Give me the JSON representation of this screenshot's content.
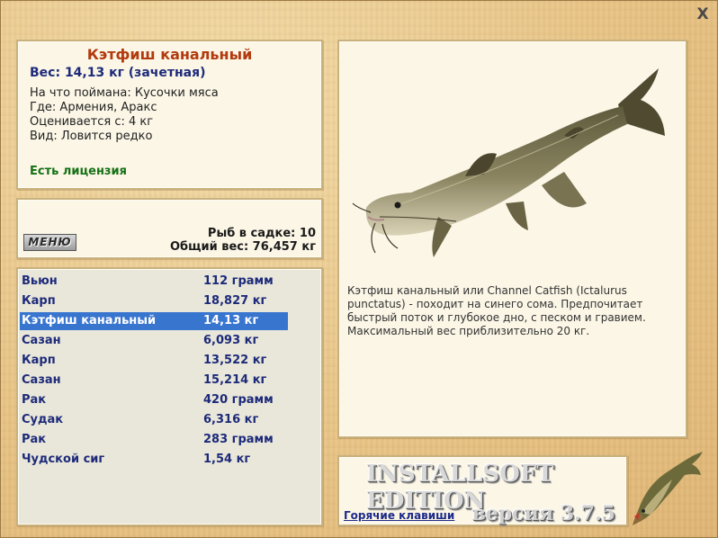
{
  "window": {
    "close_label": "X"
  },
  "info": {
    "title": "Кэтфиш канальный",
    "weight": "Вес: 14,13 кг (зачетная)",
    "caught_on": "На что поймана: Кусочки мяса",
    "location": "Где: Армения, Аракс",
    "rated_from": "Оценивается с: 4 кг",
    "kind": "Вид: Ловится редко",
    "license": "Есть лицензия"
  },
  "keep": {
    "menu_label": "МЕНЮ",
    "fish_count": "Рыб в садке: 10",
    "total_weight": "Общий вес: 76,457 кг"
  },
  "catch_list": [
    {
      "name": "Вьюн",
      "weight": "112 грамм",
      "selected": false
    },
    {
      "name": "Карп",
      "weight": "18,827 кг",
      "selected": false
    },
    {
      "name": "Кэтфиш канальный",
      "weight": "14,13 кг",
      "selected": true
    },
    {
      "name": "Сазан",
      "weight": "6,093 кг",
      "selected": false
    },
    {
      "name": "Карп",
      "weight": "13,522 кг",
      "selected": false
    },
    {
      "name": "Сазан",
      "weight": "15,214 кг",
      "selected": false
    },
    {
      "name": "Рак",
      "weight": "420 грамм",
      "selected": false
    },
    {
      "name": "Судак",
      "weight": "6,316 кг",
      "selected": false
    },
    {
      "name": "Рак",
      "weight": "283 грамм",
      "selected": false
    },
    {
      "name": "Чудской сиг",
      "weight": "1,54 кг",
      "selected": false
    }
  ],
  "description": "Кэтфиш канальный или Channel Catfish (Ictalurus punctatus) - походит на синего сома. Предпочитает быстрый поток и глубокое дно, с песком и гравием. Максимальный вес приблизительно 20 кг.",
  "brand": {
    "title": "INSTALLSOFT EDITION",
    "hotkeys": "Горячие клавиши",
    "version": "версия 3.7.5"
  },
  "icons": {
    "fish_image": "catfish-image",
    "logo": "pike-logo-icon"
  },
  "colors": {
    "title_red": "#b23a0e",
    "text_blue": "#1d2a7a",
    "license_green": "#157015",
    "selection_blue": "#3875cf"
  }
}
